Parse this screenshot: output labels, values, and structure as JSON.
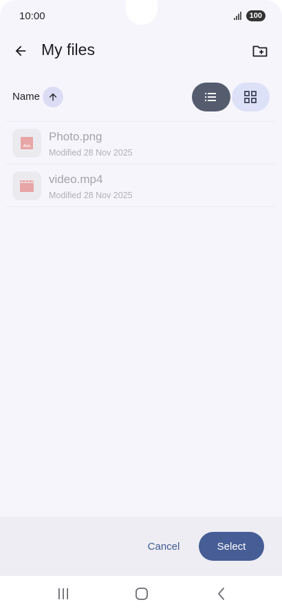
{
  "status_bar": {
    "time": "10:00",
    "battery": "100",
    "icons": [
      "signal-icon"
    ]
  },
  "app_bar": {
    "title": "My files",
    "back_icon": "arrow-left-icon",
    "action_icon": "new-folder-icon"
  },
  "sort": {
    "label": "Name",
    "direction_icon": "arrow-up-icon"
  },
  "view_toggle": {
    "selected": "list",
    "options": [
      "list-view-icon",
      "grid-view-icon"
    ]
  },
  "files": [
    {
      "name": "Photo.png",
      "modified": "Modified 28 Nov 2025",
      "icon": "image-icon"
    },
    {
      "name": "video.mp4",
      "modified": "Modified 28 Nov 2025",
      "icon": "video-clapper-icon"
    }
  ],
  "actions": {
    "cancel_label": "Cancel",
    "select_label": "Select"
  },
  "nav_bar": {
    "icons": [
      "recents-icon",
      "home-icon",
      "back-icon"
    ]
  },
  "colors": {
    "background": "#f6f5fc",
    "accent": "#465d95",
    "toggle_selected": "#545c6e",
    "toggle_unselected": "#dde1f7",
    "file_icon": "#e8a5a5"
  }
}
